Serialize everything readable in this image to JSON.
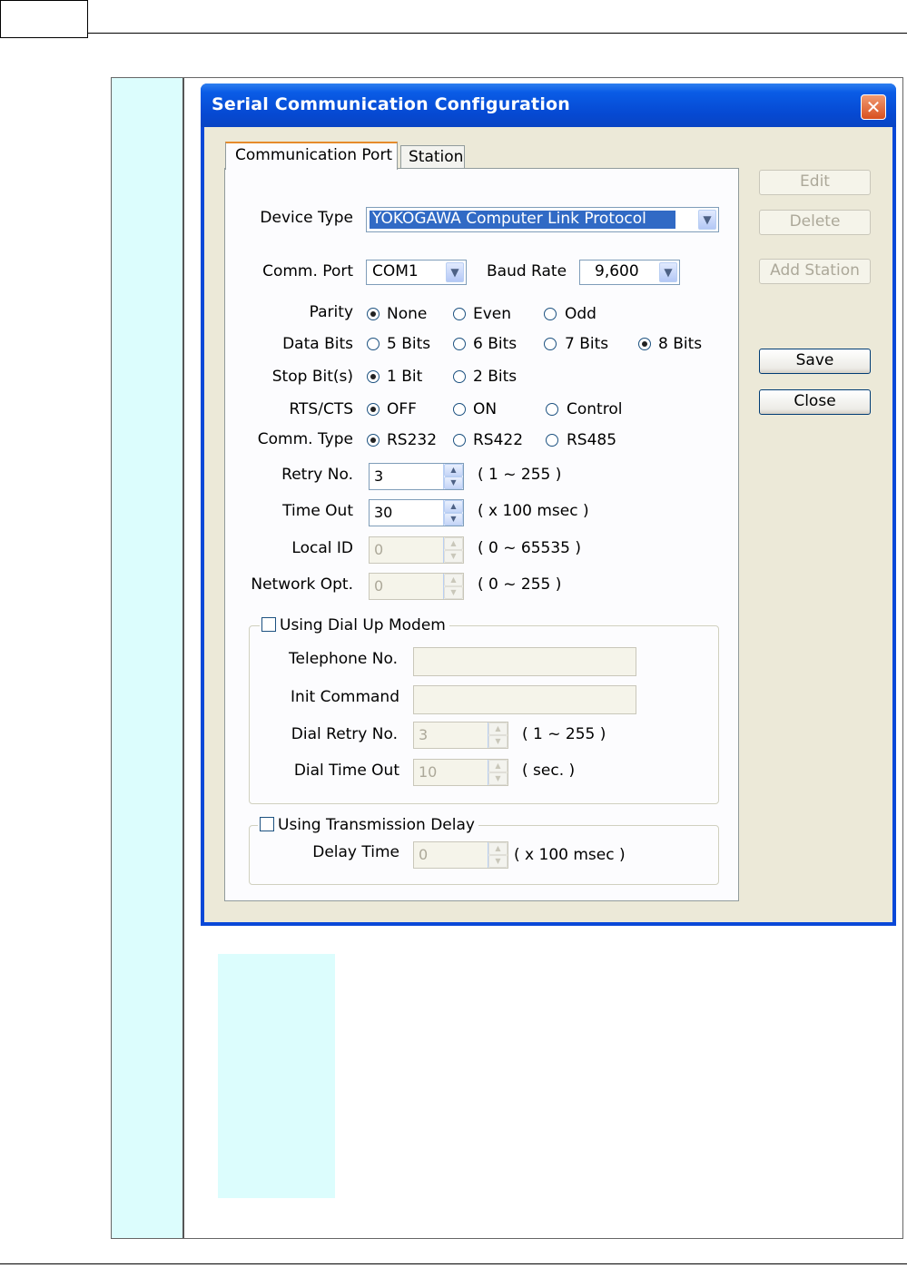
{
  "dialog": {
    "title": "Serial Communication Configuration",
    "close_glyph": "✕",
    "tabs": [
      {
        "label": "Communication Port"
      },
      {
        "label": "Station"
      }
    ]
  },
  "form": {
    "device_type": {
      "label": "Device Type",
      "value": "YOKOGAWA Computer Link Protocol"
    },
    "comm_port": {
      "label": "Comm. Port",
      "value": "COM1"
    },
    "baud_rate": {
      "label": "Baud Rate",
      "value": "9,600"
    },
    "parity": {
      "label": "Parity",
      "options": [
        "None",
        "Even",
        "Odd"
      ],
      "selected": "None"
    },
    "data_bits": {
      "label": "Data Bits",
      "options": [
        "5 Bits",
        "6 Bits",
        "7 Bits",
        "8 Bits"
      ],
      "selected": "8 Bits"
    },
    "stop_bits": {
      "label": "Stop Bit(s)",
      "options": [
        "1 Bit",
        "2 Bits"
      ],
      "selected": "1 Bit"
    },
    "rts_cts": {
      "label": "RTS/CTS",
      "options": [
        "OFF",
        "ON",
        "Control"
      ],
      "selected": "OFF"
    },
    "comm_type": {
      "label": "Comm. Type",
      "options": [
        "RS232",
        "RS422",
        "RS485"
      ],
      "selected": "RS232"
    },
    "retry_no": {
      "label": "Retry No.",
      "value": "3",
      "range": "( 1 ~ 255 )"
    },
    "time_out": {
      "label": "Time Out",
      "value": "30",
      "range": "( x 100 msec )"
    },
    "local_id": {
      "label": "Local ID",
      "value": "0",
      "range": "( 0 ~ 65535 )"
    },
    "network_opt": {
      "label": "Network Opt.",
      "value": "0",
      "range": "( 0 ~ 255 )"
    },
    "dial_up": {
      "label": "Using Dial Up Modem",
      "checked": false,
      "telephone_no": {
        "label": "Telephone No.",
        "value": ""
      },
      "init_command": {
        "label": "Init Command",
        "value": ""
      },
      "dial_retry_no": {
        "label": "Dial Retry No.",
        "value": "3",
        "range": "( 1 ~ 255 )"
      },
      "dial_time_out": {
        "label": "Dial Time Out",
        "value": "10",
        "range": "( sec. )"
      }
    },
    "transmission_delay": {
      "label": "Using Transmission Delay",
      "checked": false,
      "delay_time": {
        "label": "Delay Time",
        "value": "0",
        "range": "( x 100 msec )"
      }
    }
  },
  "buttons": {
    "edit": "Edit",
    "delete": "Delete",
    "add_station": "Add Station",
    "save": "Save",
    "close": "Close"
  },
  "colors": {
    "title_bar": "#0a5ce6",
    "side_band": "#dcfdfd",
    "dialog_face": "#ece9d8",
    "selection": "#316ac5"
  }
}
